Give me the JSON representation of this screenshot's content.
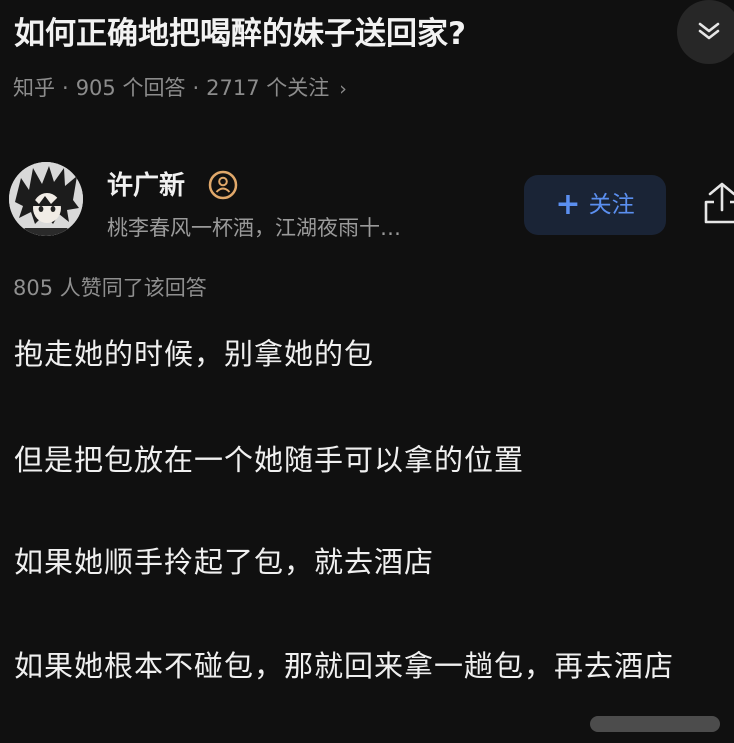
{
  "question": {
    "title": "如何正确地把喝醉的妹子送回家?",
    "source": "知乎",
    "separator": "·",
    "answers_count": "905 个回答",
    "followers_count": "2717 个关注",
    "chevron": "›"
  },
  "header": {
    "collapse_icon": "chevron-down-icon"
  },
  "author": {
    "name": "许广新",
    "bio": "桃李春风一杯酒，江湖夜雨十…",
    "badge_icon": "user-badge-icon",
    "follow_label": "关注",
    "follow_plus": "+",
    "share_icon": "share-icon"
  },
  "answer": {
    "votes": "805 人赞同了该回答",
    "paragraphs": [
      "抱走她的时候，别拿她的包",
      "但是把包放在一个她随手可以拿的位置",
      "如果她顺手拎起了包，就去酒店",
      "如果她根本不碰包，那就回来拿一趟包，再去酒店"
    ]
  },
  "colors": {
    "background": "#101010",
    "text_primary": "#f0f0f0",
    "text_secondary": "#8c8c8c",
    "accent": "#5b8ff0",
    "follow_bg": "#1a2436",
    "badge": "#e0a86a"
  }
}
